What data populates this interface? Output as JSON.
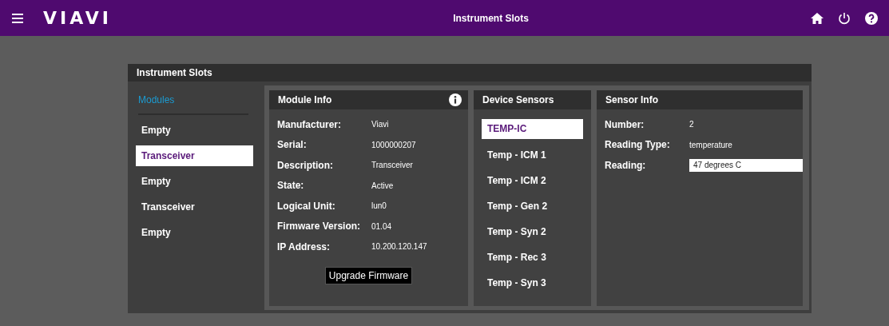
{
  "header": {
    "logo": "VIAVI",
    "title": "Instrument Slots"
  },
  "card": {
    "title": "Instrument Slots"
  },
  "modules": {
    "heading": "Modules",
    "items": [
      {
        "label": "Empty",
        "selected": false
      },
      {
        "label": "Transceiver",
        "selected": true
      },
      {
        "label": "Empty",
        "selected": false
      },
      {
        "label": "Transceiver",
        "selected": false
      },
      {
        "label": "Empty",
        "selected": false
      }
    ]
  },
  "module_info": {
    "title": "Module Info",
    "fields": [
      {
        "label": "Manufacturer:",
        "value": "Viavi"
      },
      {
        "label": "Serial:",
        "value": "1000000207"
      },
      {
        "label": "Description:",
        "value": "Transceiver"
      },
      {
        "label": "State:",
        "value": "Active"
      },
      {
        "label": "Logical Unit:",
        "value": "lun0"
      },
      {
        "label": "Firmware Version:",
        "value": "01.04"
      },
      {
        "label": "IP Address:",
        "value": "10.200.120.147"
      }
    ],
    "button": "Upgrade Firmware"
  },
  "device_sensors": {
    "title": "Device Sensors",
    "items": [
      {
        "label": "TEMP-IC",
        "selected": true
      },
      {
        "label": "Temp - ICM 1",
        "selected": false
      },
      {
        "label": "Temp - ICM 2",
        "selected": false
      },
      {
        "label": "Temp - Gen 2",
        "selected": false
      },
      {
        "label": "Temp - Syn 2",
        "selected": false
      },
      {
        "label": "Temp - Rec 3",
        "selected": false
      },
      {
        "label": "Temp - Syn 3",
        "selected": false
      }
    ]
  },
  "sensor_info": {
    "title": "Sensor Info",
    "fields": [
      {
        "label": "Number:",
        "value": "2",
        "kind": "text"
      },
      {
        "label": "Reading Type:",
        "value": "temperature",
        "kind": "text"
      },
      {
        "label": "Reading:",
        "value": "47 degrees C",
        "kind": "field"
      }
    ]
  }
}
